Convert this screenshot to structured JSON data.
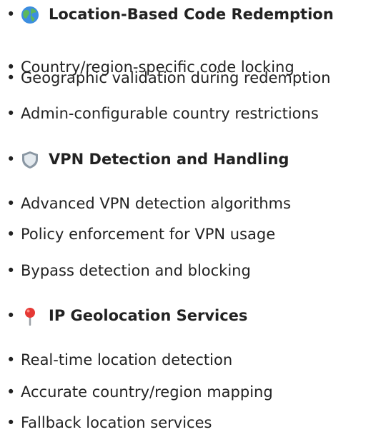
{
  "bullet": "•",
  "sections": [
    {
      "icon": "globe-icon",
      "heading": "Location-Based Code Redemption",
      "items": [
        "Country/region-specific code locking",
        "Geographic validation during redemption",
        "Admin-configurable country restrictions"
      ]
    },
    {
      "icon": "shield-icon",
      "heading": "VPN Detection and Handling",
      "items": [
        "Advanced VPN detection algorithms",
        "Policy enforcement for VPN usage",
        "Bypass detection and blocking"
      ]
    },
    {
      "icon": "pin-icon",
      "heading": "IP Geolocation Services",
      "items": [
        "Real-time location detection",
        "Accurate country/region mapping",
        "Fallback location services"
      ]
    }
  ]
}
